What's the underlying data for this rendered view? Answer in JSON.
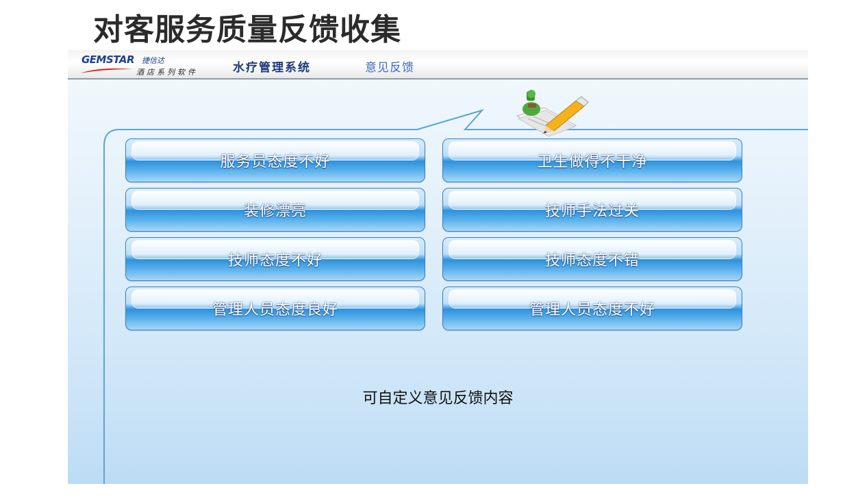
{
  "slide": {
    "title": "对客服务质量反馈收集"
  },
  "header": {
    "brand": "GEMSTAR",
    "brand_cn": "捷信达",
    "brand_sub": "酒店系列软件",
    "system_name": "水疗管理系统",
    "section_name": "意见反馈"
  },
  "feedback_options": [
    "服务员态度不好",
    "卫生做得不干净",
    "装修漂亮",
    "技师手法过关",
    "技师态度不好",
    "技师态度不错",
    "管理人员态度良好",
    "管理人员态度不好"
  ],
  "note": "可自定义意见反馈内容",
  "icons": {
    "header_logo": "gemstar-logo",
    "feedback": "feedback-pencil-icon"
  },
  "colors": {
    "button_blue": "#2e92de",
    "title_text": "#2b2b2b",
    "brand_blue": "#1f3f8f"
  }
}
